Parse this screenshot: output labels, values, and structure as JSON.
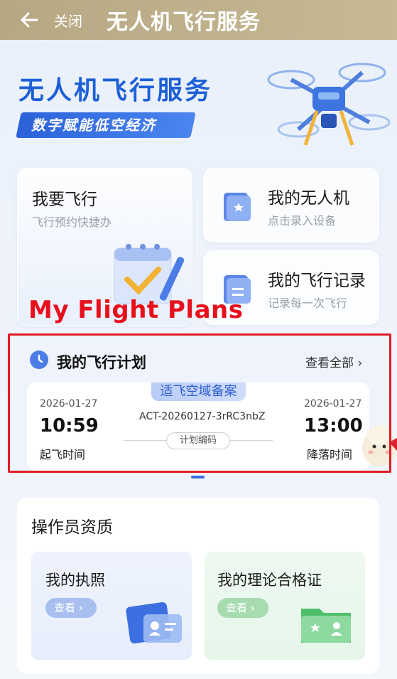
{
  "topbar": {
    "close_label": "关闭",
    "title": "无人机飞行服务"
  },
  "hero": {
    "title": "无人机飞行服务",
    "subtitle": "数字赋能低空经济"
  },
  "cards": {
    "fly": {
      "title": "我要飞行",
      "subtitle": "飞行预约快捷办"
    },
    "drone": {
      "title": "我的无人机",
      "subtitle": "点击录入设备"
    },
    "record": {
      "title": "我的飞行记录",
      "subtitle": "记录每一次飞行"
    }
  },
  "annotation": {
    "label": "My Flight Plans"
  },
  "plan": {
    "heading": "我的飞行计划",
    "view_all": "查看全部 ›",
    "tag": "适飞空域备案",
    "takeoff_date": "2026-01-27",
    "takeoff_time": "10:59",
    "takeoff_label": "起飞时间",
    "landing_date": "2026-01-27",
    "landing_time": "13:00",
    "landing_label": "降落时间",
    "plan_code": "ACT-20260127-3rRC3nbZ",
    "plan_code_label": "计划编码"
  },
  "operator": {
    "title": "操作员资质",
    "license": {
      "title": "我的执照",
      "button": "查看 ›"
    },
    "certificate": {
      "title": "我的理论合格证",
      "button": "查看 ›"
    }
  },
  "colors": {
    "header": "#b7a884",
    "brand_blue": "#1d5fd6",
    "annotation_red": "#e21c25"
  }
}
